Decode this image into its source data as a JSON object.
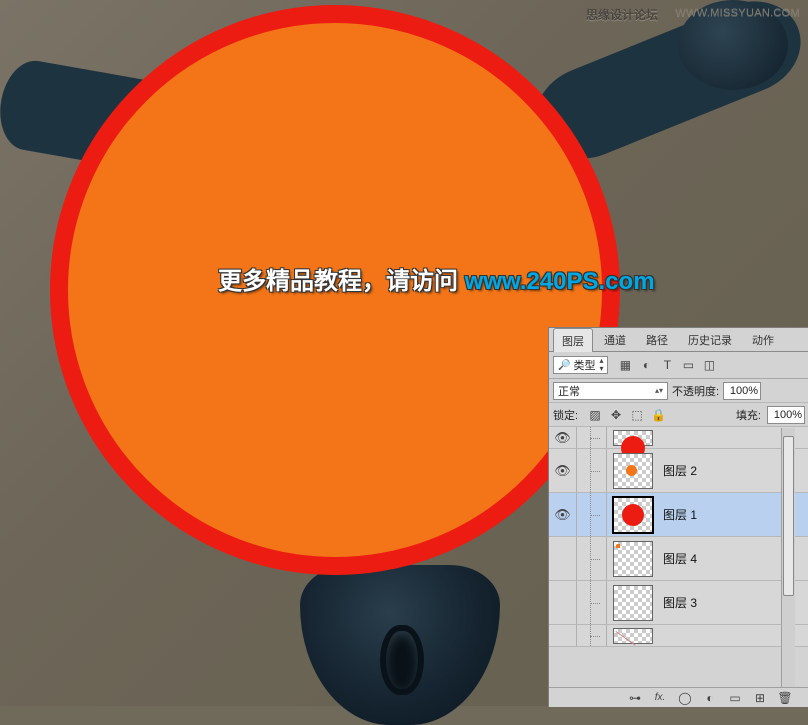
{
  "watermark": {
    "text": "思缘设计论坛",
    "url": "WWW.MISSYUAN.COM"
  },
  "caption": {
    "prefix": "更多精品教程，请访问 ",
    "url": "www.240PS.com"
  },
  "panel": {
    "tabs": [
      "图层",
      "通道",
      "路径",
      "历史记录",
      "动作"
    ],
    "active_tab_index": 0,
    "filter": {
      "kind_label": "类型",
      "icons": [
        "image-icon",
        "adjust-icon",
        "type-icon",
        "shape-icon",
        "smart-icon"
      ],
      "glyphs": [
        "▦",
        "◐",
        "T",
        "▭",
        "◫"
      ]
    },
    "blend": {
      "mode": "正常",
      "opacity_label": "不透明度:",
      "opacity_value": "100%"
    },
    "lock": {
      "label": "锁定:",
      "icons": [
        "lock-pixels-icon",
        "lock-position-icon",
        "lock-artboard-icon",
        "lock-all-icon"
      ],
      "glyphs": [
        "▨",
        "✥",
        "⬚",
        "🔒"
      ],
      "fill_label": "填充:",
      "fill_value": "100%"
    },
    "layers": [
      {
        "name": "",
        "visible": true,
        "selected": false,
        "thumb": "red-partial"
      },
      {
        "name": "图层 2",
        "visible": true,
        "selected": false,
        "thumb": "orange-dot"
      },
      {
        "name": "图层 1",
        "visible": true,
        "selected": true,
        "thumb": "red-dot"
      },
      {
        "name": "图层 4",
        "visible": false,
        "selected": false,
        "thumb": "cut"
      },
      {
        "name": "图层 3",
        "visible": false,
        "selected": false,
        "thumb": "checker"
      },
      {
        "name": "",
        "visible": false,
        "selected": false,
        "thumb": "diag-partial"
      }
    ],
    "footer_icons": [
      "link-icon",
      "fx-icon",
      "mask-icon",
      "fill-adjust-icon",
      "group-icon",
      "new-layer-icon",
      "trash-icon"
    ],
    "footer_glyphs": [
      "⊶",
      "fx.",
      "◯",
      "◐",
      "▭",
      "⊞",
      "🗑"
    ]
  }
}
